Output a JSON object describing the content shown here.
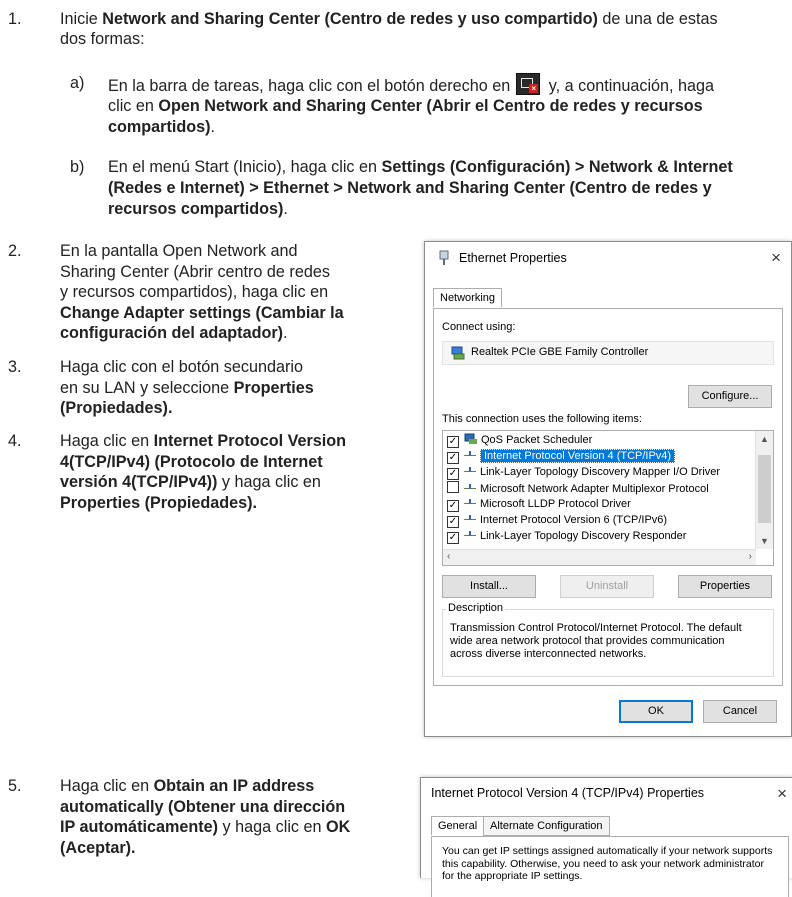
{
  "steps": {
    "s1": {
      "number": "1.",
      "pre": "Inicie ",
      "bold": "Network and Sharing Center (Centro de redes y uso compartido)",
      "post": " de una de estas",
      "line2": "dos formas:"
    },
    "s1a": {
      "letter": "a)",
      "t1": "En la barra de tareas, haga clic con el botón derecho en",
      "t2": " y, a continuación, haga",
      "t3": "clic en ",
      "b1": "Open Network and Sharing Center (Abrir el Centro de redes y recursos",
      "b2": "compartidos)",
      "t4": "."
    },
    "s1b": {
      "letter": "b)",
      "t1": "En el menú Start (Inicio), haga clic en ",
      "b1": "Settings (Configuración) > Network & Internet",
      "b2": "(Redes e Internet) > Ethernet > Network and Sharing Center (Centro de redes y",
      "b3": "recursos compartidos)",
      "t2": "."
    },
    "s2": {
      "number": "2.",
      "l1": "En la pantalla Open Network and",
      "l2": "Sharing Center (Abrir centro de redes",
      "l3": "y recursos compartidos), haga clic en",
      "b1": "Change Adapter settings (Cambiar la",
      "b2": "configuración del adaptador)",
      "t_end": "."
    },
    "s3": {
      "number": "3.",
      "l1": "Haga clic con el botón secundario",
      "l2": "en su LAN y seleccione ",
      "b1": "Properties",
      "b2": "(Propiedades)."
    },
    "s4": {
      "number": "4.",
      "l1": "Haga clic en ",
      "b1": "Internet Protocol Version",
      "b2": "4(TCP/IPv4) (Protocolo de Internet",
      "b3": "versión 4(TCP/IPv4))",
      "t2": " y haga clic en",
      "b4": "Properties (Propiedades)."
    },
    "s5": {
      "number": "5.",
      "l1": "Haga clic en ",
      "b1": "Obtain an IP address",
      "b2": "automatically (Obtener una dirección",
      "b3": "IP automáticamente)",
      "t2": " y haga clic en ",
      "b4": "OK",
      "b5": "(Aceptar)."
    }
  },
  "dialog1": {
    "title": "Ethernet Properties",
    "close": "×",
    "tab": "Networking",
    "connect_using": "Connect using:",
    "adapter": "Realtek PCIe GBE Family Controller",
    "configure": "Configure...",
    "items_label": "This connection uses the following items:",
    "items": [
      {
        "label": "QoS Packet Scheduler",
        "checked": true
      },
      {
        "label": "Internet Protocol Version 4 (TCP/IPv4)",
        "checked": true,
        "selected": true
      },
      {
        "label": "Link-Layer Topology Discovery Mapper I/O Driver",
        "checked": true
      },
      {
        "label": "Microsoft Network Adapter Multiplexor Protocol",
        "checked": false
      },
      {
        "label": "Microsoft LLDP Protocol Driver",
        "checked": true
      },
      {
        "label": "Internet Protocol Version 6 (TCP/IPv6)",
        "checked": true
      },
      {
        "label": "Link-Layer Topology Discovery Responder",
        "checked": true
      }
    ],
    "install": "Install...",
    "uninstall": "Uninstall",
    "properties": "Properties",
    "description_label": "Description",
    "desc1": "Transmission Control Protocol/Internet Protocol. The default",
    "desc2": "wide area network protocol that provides communication",
    "desc3": "across diverse interconnected networks.",
    "ok": "OK",
    "cancel": "Cancel"
  },
  "dialog2": {
    "title": "Internet Protocol Version 4 (TCP/IPv4) Properties",
    "close": "×",
    "tab_general": "General",
    "tab_alternate": "Alternate Configuration",
    "text1": "You can get IP settings assigned automatically if your network supports",
    "text2": "this capability. Otherwise, you need to ask your network administrator",
    "text3": "for the appropriate IP settings."
  },
  "colors": {
    "selection": "#0078d7",
    "icon_red": "#d21f1f"
  }
}
